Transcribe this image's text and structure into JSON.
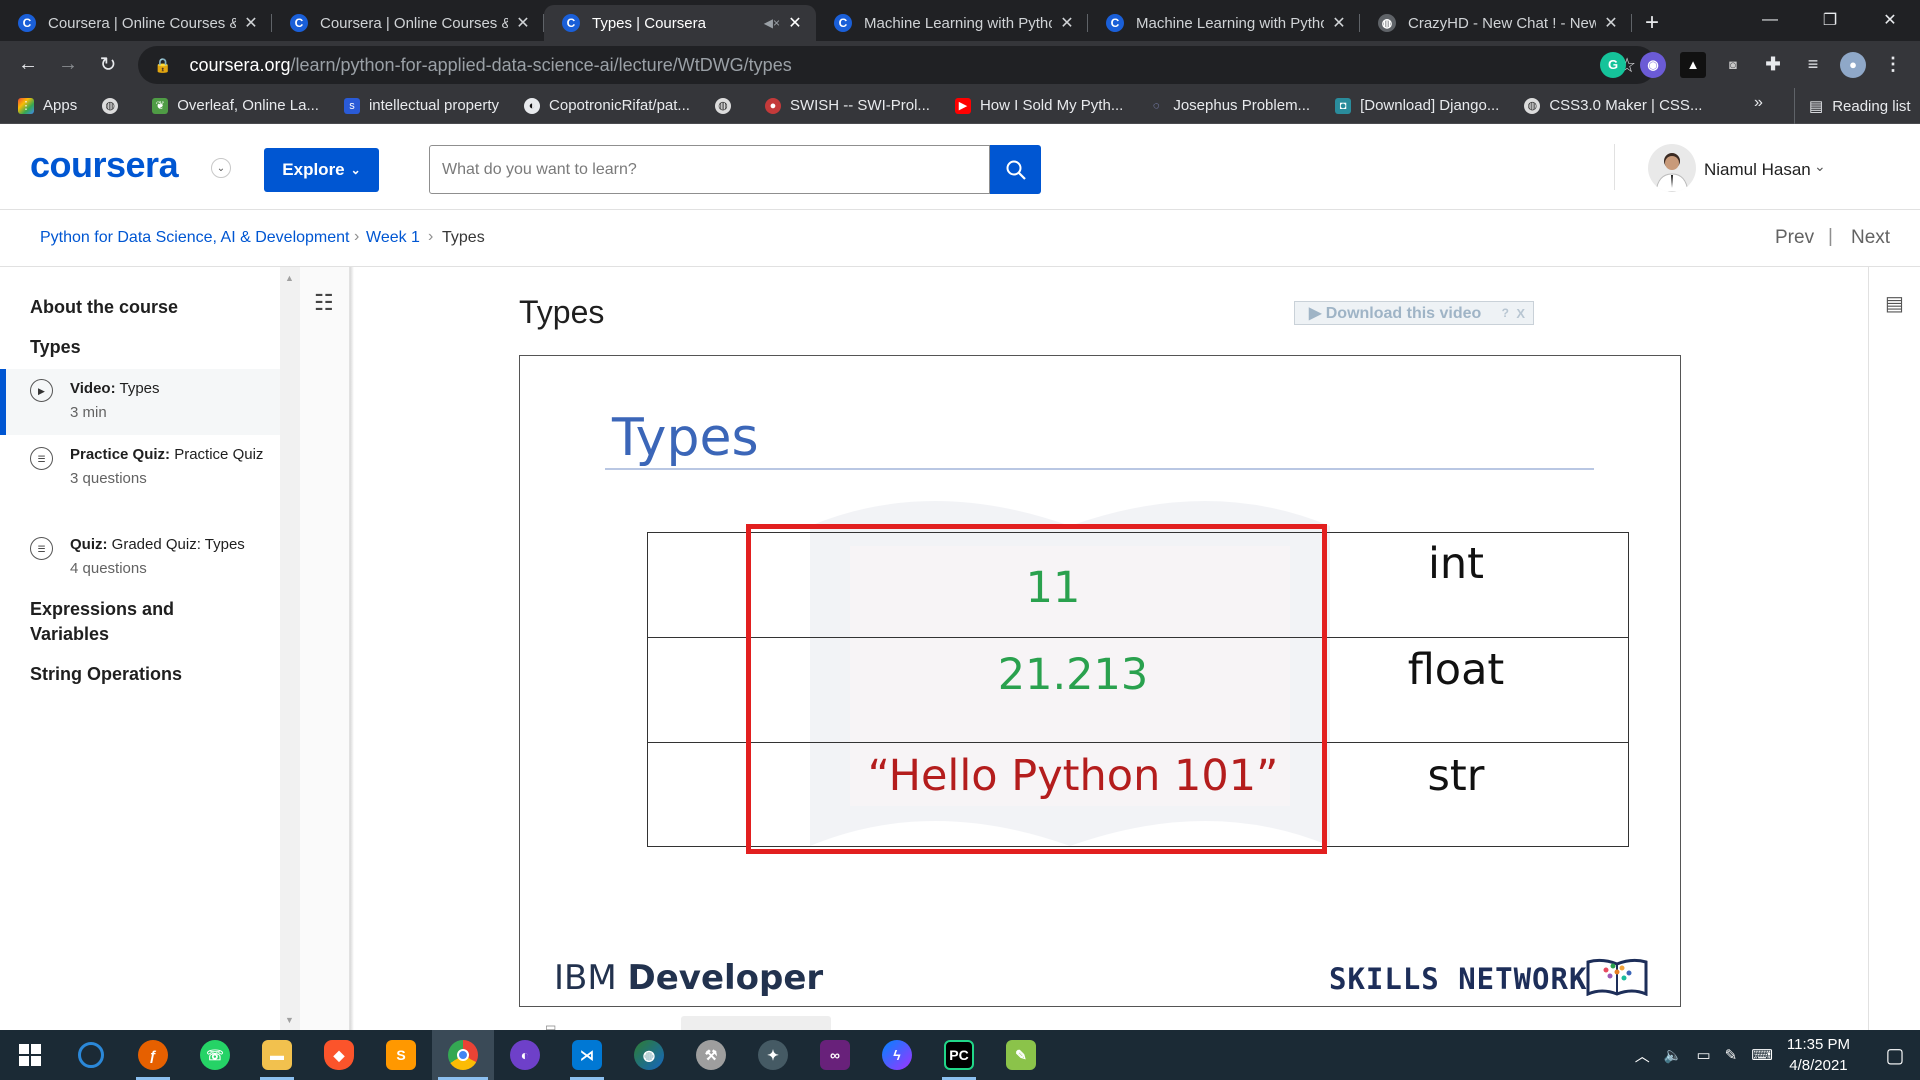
{
  "browser": {
    "tabs": [
      {
        "title": "Coursera | Online Courses & Cre",
        "favicon": "C",
        "active": false
      },
      {
        "title": "Coursera | Online Courses & Cre",
        "favicon": "C",
        "active": false
      },
      {
        "title": "Types | Coursera",
        "favicon": "C",
        "active": true
      },
      {
        "title": "Machine Learning with Python",
        "favicon": "C",
        "active": false
      },
      {
        "title": "Machine Learning with Python",
        "favicon": "C",
        "active": false
      },
      {
        "title": "CrazyHD - New Chat ! - New Cha",
        "favicon": "globe",
        "active": false
      }
    ],
    "url_host": "coursera.org",
    "url_path": "/learn/python-for-applied-data-science-ai/lecture/WtDWG/types",
    "bookmarks": [
      {
        "label": "Apps",
        "icon": "apps-grid-icon"
      },
      {
        "label": "",
        "icon": "globe-icon"
      },
      {
        "label": "Overleaf, Online La...",
        "icon": "overleaf-icon"
      },
      {
        "label": "intellectual property",
        "icon": "s-icon"
      },
      {
        "label": "CopotronicRifat/pat...",
        "icon": "github-icon"
      },
      {
        "label": "",
        "icon": "globe-icon"
      },
      {
        "label": "SWISH -- SWI-Prol...",
        "icon": "swish-icon"
      },
      {
        "label": "How I Sold My Pyth...",
        "icon": "youtube-icon"
      },
      {
        "label": "Josephus Problem...",
        "icon": "spinner-icon"
      },
      {
        "label": "[Download] Django...",
        "icon": "download-site-icon"
      },
      {
        "label": "CSS3.0 Maker | CSS...",
        "icon": "globe-icon"
      }
    ],
    "bookmarks_overflow": "»",
    "reading_list": "Reading list"
  },
  "header": {
    "logo": "coursera",
    "explore_label": "Explore",
    "search_placeholder": "What do you want to learn?",
    "user_name": "Niamul Hasan"
  },
  "breadcrumb": {
    "course": "Python for Data Science, AI & Development",
    "week": "Week 1",
    "current": "Types",
    "prev": "Prev",
    "next": "Next"
  },
  "sidebar": {
    "about": "About the course",
    "section": "Types",
    "items": [
      {
        "kind": "Video:",
        "title": "Types",
        "meta": "3 min",
        "active": true,
        "icon": "play-circle-icon"
      },
      {
        "kind": "Practice Quiz:",
        "title": "Practice Quiz",
        "meta": "3 questions",
        "active": false,
        "icon": "quiz-icon"
      },
      {
        "kind": "Quiz:",
        "title": "Graded Quiz: Types",
        "meta": "4 questions",
        "active": false,
        "icon": "quiz-icon"
      }
    ],
    "sections_after": [
      "Expressions and Variables",
      "String Operations"
    ]
  },
  "main": {
    "title": "Types",
    "download_label": "▶ Download this video",
    "download_help": "?",
    "download_close": "X"
  },
  "slide": {
    "title": "Types",
    "rows": [
      {
        "value": "11",
        "value_color": "#2aa14e",
        "type": "int"
      },
      {
        "value": "21.213",
        "value_color": "#2aa14e",
        "type": "float"
      },
      {
        "value": "“Hello Python 101”",
        "value_color": "#b41d1d",
        "type": "str"
      }
    ],
    "footer_left_light": "IBM ",
    "footer_left_bold": "Developer",
    "footer_right": "SKILLS NETWORK"
  },
  "taskbar": {
    "apps": [
      "search-icon",
      "firefox-icon",
      "whatsapp-icon",
      "file-explorer-icon",
      "brave-icon",
      "sublime-icon",
      "chrome-icon",
      "github-desktop-icon",
      "vscode-icon",
      "world-icon",
      "wrench-icon",
      "satellite-icon",
      "visual-studio-icon",
      "messenger-icon",
      "pycharm-icon",
      "notepad-icon"
    ],
    "time": "11:35 PM",
    "date": "4/8/2021"
  },
  "colors": {
    "accent": "#0056d2",
    "chrome_dark": "#202124",
    "chrome_mid": "#35363a",
    "slide_title": "#3b66b8",
    "red_box": "#e21f1f"
  }
}
